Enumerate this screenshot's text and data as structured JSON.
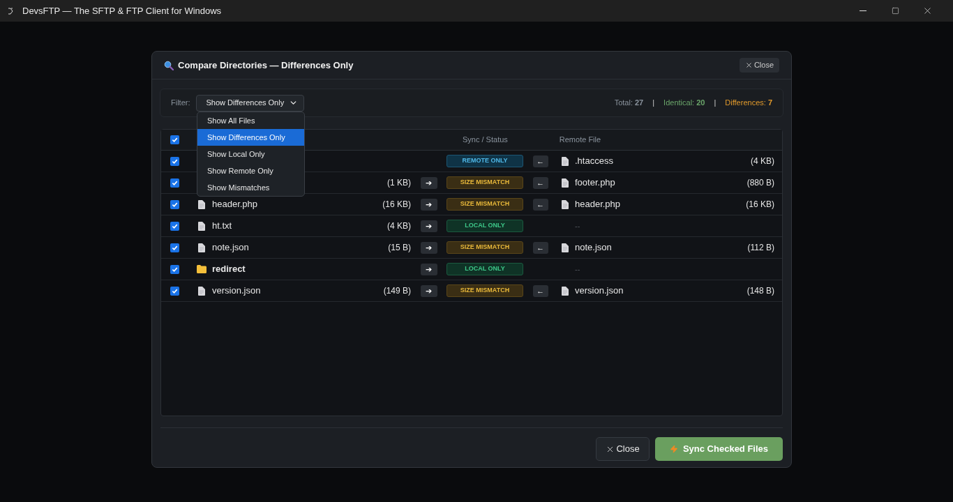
{
  "window": {
    "title": "DevsFTP — The SFTP & FTP Client for Windows"
  },
  "dialog": {
    "title": "Compare Directories — Differences Only",
    "close_label": "Close"
  },
  "filter": {
    "label": "Filter:",
    "value": "Show Differences Only",
    "expanded": true,
    "options": [
      {
        "label": "Show All Files",
        "selected": false
      },
      {
        "label": "Show Differences Only",
        "selected": true
      },
      {
        "label": "Show Local Only",
        "selected": false
      },
      {
        "label": "Show Remote Only",
        "selected": false
      },
      {
        "label": "Show Mismatches",
        "selected": false
      }
    ]
  },
  "stats": [
    {
      "kind": "total",
      "label": "Total:",
      "value": "27"
    },
    {
      "kind": "identical",
      "label": "Identical:",
      "value": "20"
    },
    {
      "kind": "differences",
      "label": "Differences:",
      "value": "7"
    }
  ],
  "stat_separators": [
    "|",
    "|"
  ],
  "table": {
    "select_all": {
      "checked": true
    },
    "columns": [
      "Sync / Status",
      "Remote File"
    ],
    "rows": [
      {
        "checked": true,
        "local": null,
        "push": null,
        "status": {
          "kind": "remote",
          "label": "REMOTE ONLY"
        },
        "pull": "←",
        "remote": {
          "name": ".htaccess",
          "size": "(4 KB)"
        }
      },
      {
        "checked": true,
        "local": {
          "kind": "file",
          "size": "(1 KB)"
        },
        "push": "➔",
        "status": {
          "kind": "mismatch",
          "label": "SIZE MISMATCH"
        },
        "pull": "←",
        "remote": {
          "name": "footer.php",
          "size": "(880 B)"
        }
      },
      {
        "checked": true,
        "local": {
          "kind": "file",
          "name": "header.php",
          "size": "(16 KB)"
        },
        "push": "➔",
        "status": {
          "kind": "mismatch",
          "label": "SIZE MISMATCH"
        },
        "pull": "←",
        "remote": {
          "name": "header.php",
          "size": "(16 KB)"
        }
      },
      {
        "checked": true,
        "local": {
          "kind": "file",
          "name": "ht.txt",
          "size": "(4 KB)"
        },
        "push": "➔",
        "status": {
          "kind": "local",
          "label": "LOCAL ONLY"
        },
        "pull": null,
        "remote": {
          "missing": "--"
        }
      },
      {
        "checked": true,
        "local": {
          "kind": "file",
          "name": "note.json",
          "size": "(15 B)"
        },
        "push": "➔",
        "status": {
          "kind": "mismatch",
          "label": "SIZE MISMATCH"
        },
        "pull": "←",
        "remote": {
          "name": "note.json",
          "size": "(112 B)"
        }
      },
      {
        "checked": true,
        "local": {
          "kind": "folder",
          "name": "redirect"
        },
        "push": "➔",
        "status": {
          "kind": "local",
          "label": "LOCAL ONLY"
        },
        "pull": null,
        "remote": {
          "missing": "--"
        }
      },
      {
        "checked": true,
        "local": {
          "kind": "file",
          "name": "version.json",
          "size": "(149 B)"
        },
        "push": "➔",
        "status": {
          "kind": "mismatch",
          "label": "SIZE MISMATCH"
        },
        "pull": "←",
        "remote": {
          "name": "version.json",
          "size": "(148 B)"
        }
      }
    ]
  },
  "footer": {
    "close_label": "Close",
    "sync_label": "Sync Checked Files"
  }
}
